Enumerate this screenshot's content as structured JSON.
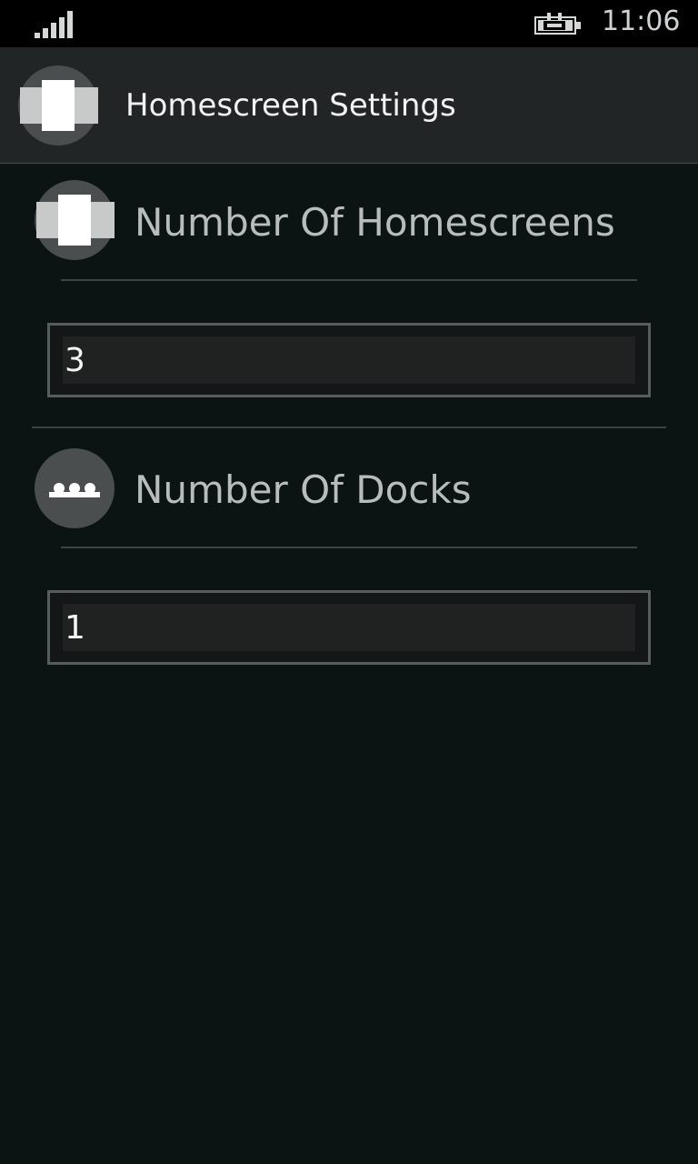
{
  "status_bar": {
    "time": "11:06",
    "signal_icon": "signal-strength-icon",
    "battery_icon": "battery-charging-icon"
  },
  "header": {
    "title": "Homescreen Settings",
    "icon": "homescreen-icon"
  },
  "sections": [
    {
      "title": "Number Of Homescreens",
      "icon": "homescreen-icon",
      "value": "3"
    },
    {
      "title": "Number Of Docks",
      "icon": "dock-icon",
      "value": "1"
    }
  ],
  "colors": {
    "background": "#0b1313",
    "header_bg": "#222525",
    "icon_circle": "#4a4e4e",
    "icon_fg": "#ffffff",
    "icon_side": "#c8caca",
    "field_border": "#575c5c",
    "section_title": "#b9bcbc"
  }
}
